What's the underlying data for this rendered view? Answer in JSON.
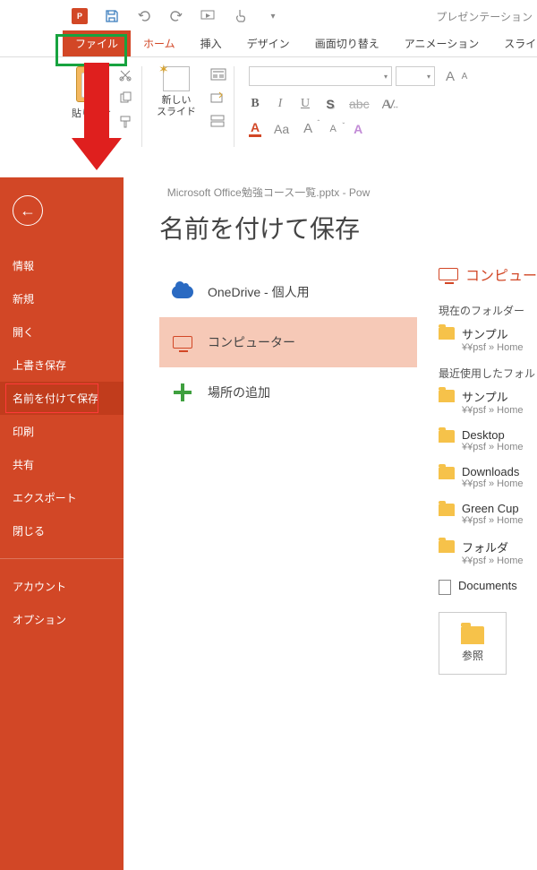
{
  "title_bar": {
    "doc_type": "プレゼンテーション"
  },
  "qat": {
    "ppt_badge": "P"
  },
  "tabs": {
    "file": "ファイル",
    "home": "ホーム",
    "insert": "挿入",
    "design": "デザイン",
    "transitions": "画面切り替え",
    "animations": "アニメーション",
    "slideshow": "スライド ショー"
  },
  "ribbon": {
    "paste": "貼り付け",
    "new_slide": "新しい\nスライド",
    "font_placeholder": "",
    "size_placeholder": "",
    "buttons": {
      "bold": "B",
      "italic": "I",
      "underline": "U",
      "shadow": "S",
      "strike": "abc",
      "spacing": "AV",
      "fontcolor": "A",
      "case": "Aa",
      "grow": "A",
      "shrink": "A",
      "clear": "A"
    }
  },
  "backstage": {
    "window_title": "Microsoft Office勉強コース一覧.pptx - Pow",
    "heading": "名前を付けて保存",
    "menu": {
      "info": "情報",
      "new": "新規",
      "open": "開く",
      "save": "上書き保存",
      "saveas": "名前を付けて保存",
      "print": "印刷",
      "share": "共有",
      "export": "エクスポート",
      "close": "閉じる",
      "account": "アカウント",
      "options": "オプション"
    },
    "save_targets": {
      "onedrive": "OneDrive - 個人用",
      "computer": "コンピューター",
      "addplace": "場所の追加"
    },
    "right": {
      "title": "コンピュー",
      "current_folder_label": "現在のフォルダー",
      "recent_label": "最近使用したフォル",
      "browse": "参照",
      "folders": [
        {
          "name": "サンプル",
          "path": "¥¥psf » Home"
        },
        {
          "name": "サンプル",
          "path": "¥¥psf » Home"
        },
        {
          "name": "Desktop",
          "path": "¥¥psf » Home"
        },
        {
          "name": "Downloads",
          "path": "¥¥psf » Home"
        },
        {
          "name": "Green Cup",
          "path": "¥¥psf » Home"
        },
        {
          "name": "フォルダ",
          "path": "¥¥psf » Home"
        },
        {
          "name": "Documents",
          "path": ""
        }
      ]
    }
  }
}
